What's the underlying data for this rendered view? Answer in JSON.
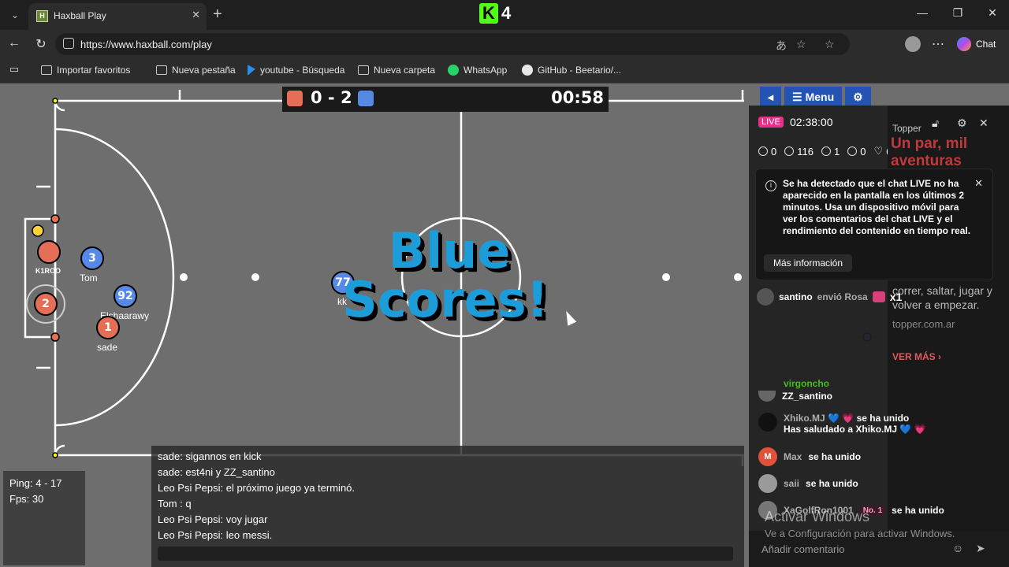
{
  "browser": {
    "tab_title": "Haxball Play",
    "tab_favicon": "H",
    "url": "https://www.haxball.com/play",
    "chat_label": "Chat",
    "kick_number": "4"
  },
  "bookmarks": [
    {
      "label": "Importar favoritos",
      "icon": "import-icon"
    },
    {
      "label": "Nueva pestaña",
      "icon": "tab-icon"
    },
    {
      "label": "youtube - Búsqueda",
      "icon": "bing-icon"
    },
    {
      "label": "Nueva carpeta",
      "icon": "folder-icon"
    },
    {
      "label": "WhatsApp",
      "icon": "whatsapp-icon"
    },
    {
      "label": "GitHub - Beetario/...",
      "icon": "github-icon"
    }
  ],
  "game": {
    "score": "0 - 2",
    "time": "00:58",
    "red_color": "#e56e56",
    "blue_color": "#5689e5",
    "overlay_line1": "Blue",
    "overlay_line2": "Scores!",
    "menu_label": "Menu",
    "players": [
      {
        "number": "",
        "name": "K1ROO",
        "team": "red"
      },
      {
        "number": "3",
        "name": "Tom",
        "team": "blue"
      },
      {
        "number": "2",
        "name": "",
        "team": "red"
      },
      {
        "number": "92",
        "name": "Elshaarawy",
        "team": "blue"
      },
      {
        "number": "1",
        "name": "sade",
        "team": "red"
      },
      {
        "number": "77",
        "name": "kk",
        "team": "blue"
      }
    ],
    "stats": {
      "ping": "Ping: 4 - 17",
      "fps": "Fps: 30"
    },
    "chat": [
      "sade: sigannos en kick",
      "sade: est4ni y ZZ_santino",
      "Leo Psi Pepsi: el próximo juego ya terminó.",
      "Tom : q",
      "Leo Psi Pepsi: voy jugar",
      "Leo Psi Pepsi: leo messi."
    ]
  },
  "kick": {
    "live": "LIVE",
    "duration": "02:38:00",
    "stats": {
      "followers": "0",
      "viewers": "116",
      "gifts": "1",
      "subs": "0",
      "likes": "646"
    },
    "notice": "Se ha detectado que el chat LIVE no ha aparecido en la pantalla en los últimos 2 minutos. Usa un dispositivo móvil para ver los comentarios del chat LIVE y el rendimiento del contenido en tiempo real.",
    "notice_button": "Más información",
    "gift": {
      "user": "santino",
      "action": "envió Rosa",
      "count": "x1"
    },
    "truncated_name": "virgoncho",
    "messages": [
      {
        "name": "",
        "text": "ZZ_santino",
        "badge": ""
      },
      {
        "name": "Xhiko.MJ 💙 💗",
        "text": "se ha unido",
        "badge": ""
      },
      {
        "name": "",
        "text": "Has saludado a Xhiko.MJ 💙 💗",
        "badge": ""
      },
      {
        "name": "Max",
        "text": "se ha unido",
        "badge": ""
      },
      {
        "name": "saii",
        "text": "se ha unido",
        "badge": ""
      },
      {
        "name": "XaGolfRon1001",
        "text": "se ha unido",
        "badge": "No. 1"
      }
    ],
    "input_placeholder": "Añadir comentario",
    "ad": {
      "brand": "Topper",
      "headline": "Un par, mil aventuras",
      "text": "correr, saltar, jugar y volver a empezar.",
      "url": "topper.com.ar",
      "more": "VER MÁS"
    }
  },
  "windows": {
    "watermark_title": "Activar Windows",
    "watermark_sub": "Ve a Configuración para activar Windows."
  }
}
